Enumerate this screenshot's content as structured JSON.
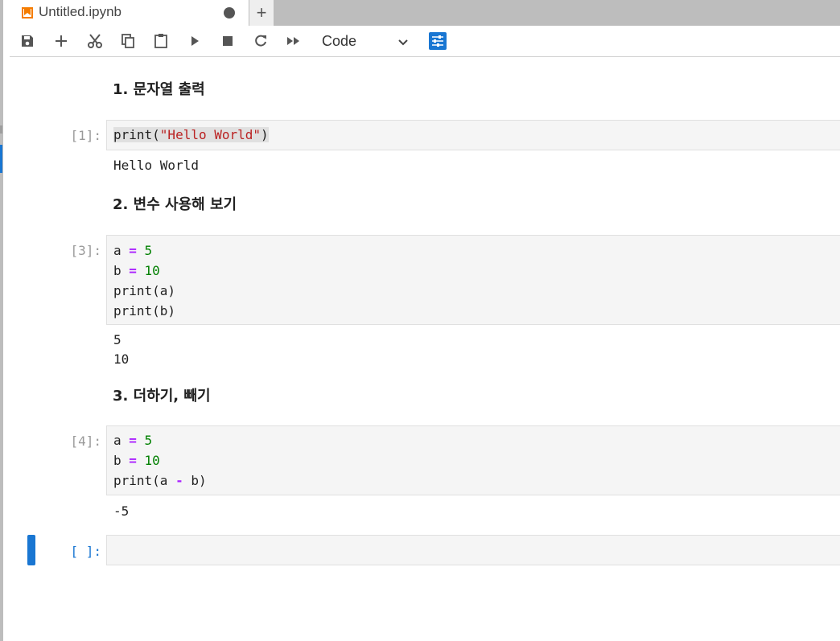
{
  "tab": {
    "title": "Untitled.ipynb",
    "new_tab_label": "+"
  },
  "toolbar": {
    "buttons": [
      "save-icon",
      "add-cell-icon",
      "cut-icon",
      "copy-icon",
      "paste-icon",
      "run-icon",
      "stop-icon",
      "restart-icon",
      "run-all-icon"
    ],
    "cell_type": "Code"
  },
  "cells": [
    {
      "type": "markdown",
      "text": "1. 문자열 출력"
    },
    {
      "type": "code",
      "prompt": "[1]:",
      "code": [
        "print(\"Hello World\")"
      ],
      "output": [
        "Hello World"
      ]
    },
    {
      "type": "markdown",
      "text": "2. 변수 사용해 보기"
    },
    {
      "type": "code",
      "prompt": "[3]:",
      "code": [
        "a = 5",
        "b = 10",
        "print(a)",
        "print(b)"
      ],
      "output": [
        "5",
        "10"
      ]
    },
    {
      "type": "markdown",
      "text": "3. 더하기, 빼기"
    },
    {
      "type": "code",
      "prompt": "[4]:",
      "code": [
        "a = 5",
        "b = 10",
        "print(a - b)"
      ],
      "output": [
        "-5"
      ]
    },
    {
      "type": "code",
      "prompt": "[ ]:",
      "code": [],
      "output": []
    }
  ],
  "colors": {
    "accent": "#1976d2",
    "string": "#ba2121",
    "operator": "#aa22ff",
    "number": "#008000"
  }
}
